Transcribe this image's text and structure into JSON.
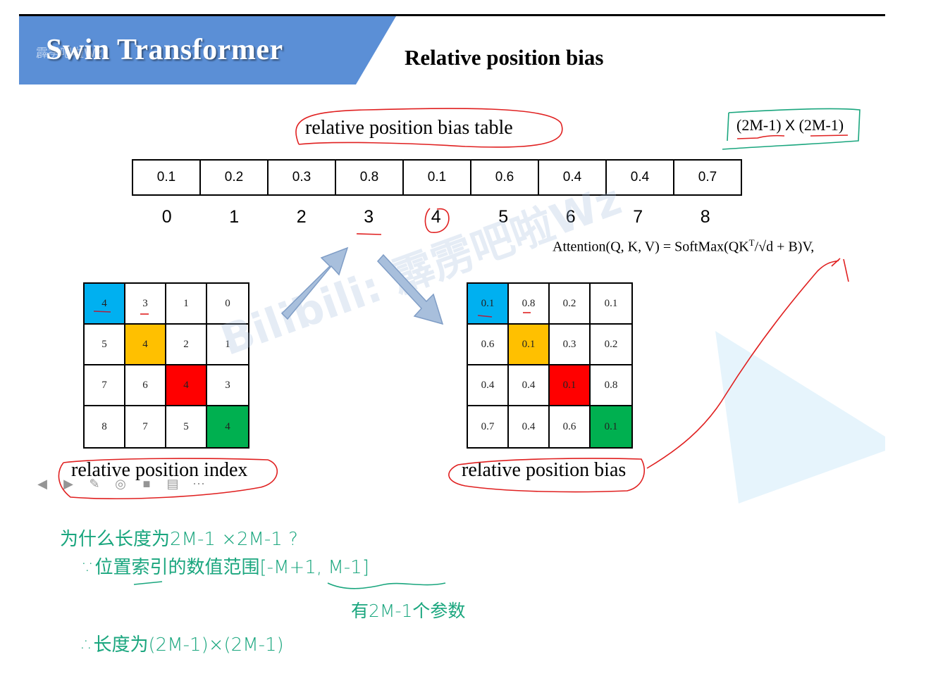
{
  "header": {
    "banner_title": "Swin Transformer",
    "banner_watermark": "霹雳吧啦Wz",
    "slide_title": "Relative position bias",
    "banner_color": "#5b8fd6"
  },
  "bias_table": {
    "caption": "relative position bias table",
    "values": [
      "0.1",
      "0.2",
      "0.3",
      "0.8",
      "0.1",
      "0.6",
      "0.4",
      "0.4",
      "0.7"
    ],
    "indices": [
      "0",
      "1",
      "2",
      "3",
      "4",
      "5",
      "6",
      "7",
      "8"
    ],
    "underlined_index": "3",
    "circled_index": "4"
  },
  "dims": {
    "left": "(2M-1)",
    "times": "X",
    "right": "(2M-1)"
  },
  "formula": {
    "lhs": "Attention(Q, K, V)",
    "eq": " = ",
    "rhs_prefix": "SoftMax(QK",
    "sup": "T",
    "rhs_mid": "/√d + B)V,"
  },
  "index_grid": {
    "caption": "relative position index",
    "cells": [
      "4",
      "3",
      "1",
      "0",
      "5",
      "4",
      "2",
      "1",
      "7",
      "6",
      "4",
      "3",
      "8",
      "7",
      "5",
      "4"
    ]
  },
  "bias_grid": {
    "caption": "relative position bias",
    "cells": [
      "0.1",
      "0.8",
      "0.2",
      "0.1",
      "0.6",
      "0.1",
      "0.3",
      "0.2",
      "0.4",
      "0.4",
      "0.1",
      "0.8",
      "0.7",
      "0.4",
      "0.6",
      "0.1"
    ]
  },
  "diagonal_colors": [
    "#00b0f0",
    "#ffc000",
    "#ff0000",
    "#00b050"
  ],
  "player_toolbar": {
    "buttons": [
      {
        "name": "previous",
        "glyph": "◀"
      },
      {
        "name": "next",
        "glyph": "▶"
      },
      {
        "name": "pen",
        "glyph": "✎"
      },
      {
        "name": "screenshot",
        "glyph": "◎"
      },
      {
        "name": "camera",
        "glyph": "■"
      },
      {
        "name": "subtitle",
        "glyph": "▤"
      },
      {
        "name": "more",
        "glyph": "⋯"
      }
    ]
  },
  "handwritten_notes": {
    "question": "为什么长度为2M-1 ×2M-1 ?",
    "because": "∵位置索引的数值范围[-M+1, M-1]",
    "count": "有2M-1个参数",
    "therefore": "∴长度为(2M-1)×(2M-1)"
  },
  "watermark": "Bilibili: 霹雳吧啦Wz",
  "annotation_colors": {
    "red": "#e02020",
    "green": "#1aa67e",
    "arrow": "#a8bfdc"
  }
}
